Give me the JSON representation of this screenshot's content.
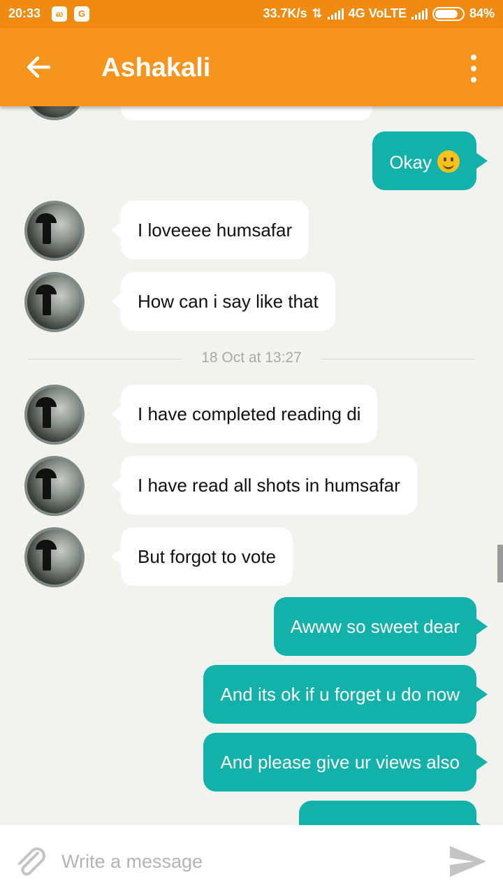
{
  "status_bar": {
    "time": "20:33",
    "net_speed": "33.7K/s",
    "network": "4G VoLTE",
    "battery": "84%",
    "battery_level": 0.84,
    "notif_icons": [
      "book-app-icon",
      "google-icon"
    ],
    "notif_glyphs": [
      "ல",
      "G"
    ]
  },
  "app_bar": {
    "title": "Ashakali",
    "back_icon": "arrow-left-icon",
    "menu_icon": "more-vert-icon",
    "color": "#f7941d"
  },
  "messages": [
    {
      "direction": "out",
      "text": "Okay",
      "emoji": "slightly-smiling-face"
    },
    {
      "direction": "in",
      "text": "I loveeee humsafar"
    },
    {
      "direction": "in",
      "text": "How can i say like that"
    },
    {
      "direction": "in",
      "text": "I have completed reading di"
    },
    {
      "direction": "in",
      "text": "I have read all shots in humsafar"
    },
    {
      "direction": "in",
      "text": "But forgot to vote"
    },
    {
      "direction": "out",
      "text": "Awww so sweet dear"
    },
    {
      "direction": "out",
      "text": "And its ok if u forget u do now"
    },
    {
      "direction": "out",
      "text": "And please give ur views also"
    }
  ],
  "date_separator": "18 Oct at 13:27",
  "composer": {
    "placeholder": "Write a message",
    "attach_icon": "paperclip-icon",
    "send_icon": "send-icon"
  },
  "colors": {
    "outgoing_bubble": "#12b1aa",
    "incoming_bubble": "#ffffff",
    "background": "#f2f3ef",
    "status_bar": "#f08a10"
  }
}
